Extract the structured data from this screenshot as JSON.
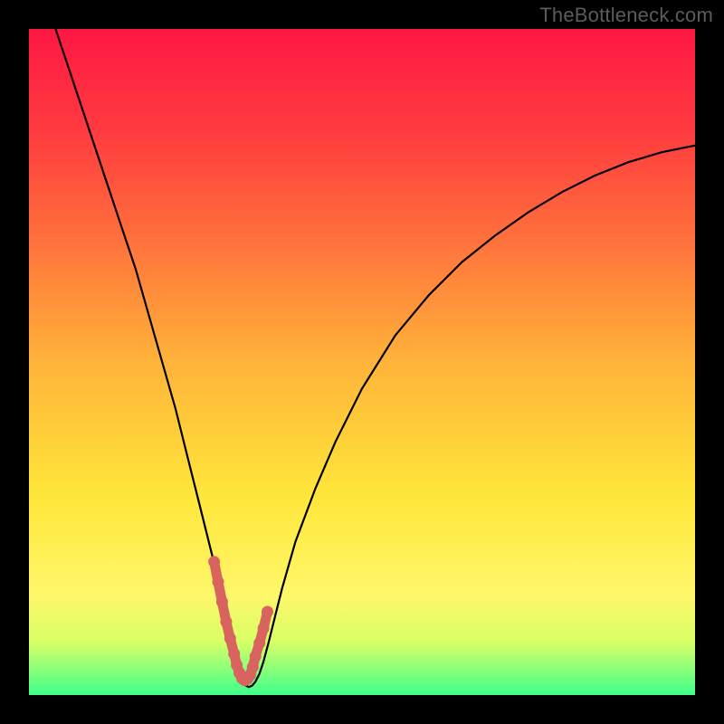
{
  "watermark_text": "TheBottleneck.com",
  "chart_data": {
    "type": "line",
    "title": "",
    "xlabel": "",
    "ylabel": "",
    "xlim": [
      0,
      100
    ],
    "ylim": [
      0,
      100
    ],
    "grid": false,
    "legend": false,
    "background_gradient": {
      "direction": "vertical",
      "stops": [
        {
          "pos": 0.0,
          "color": "#ff1744"
        },
        {
          "pos": 0.15,
          "color": "#ff3a3f"
        },
        {
          "pos": 0.3,
          "color": "#ff6b3c"
        },
        {
          "pos": 0.5,
          "color": "#ffb33a"
        },
        {
          "pos": 0.7,
          "color": "#ffe63a"
        },
        {
          "pos": 0.85,
          "color": "#fff76a"
        },
        {
          "pos": 0.92,
          "color": "#d8ff66"
        },
        {
          "pos": 0.96,
          "color": "#8dff7a"
        },
        {
          "pos": 1.0,
          "color": "#3dff88"
        }
      ]
    },
    "series": [
      {
        "name": "bottleneck-curve",
        "stroke": "#000000",
        "x": [
          4,
          6,
          8,
          10,
          12,
          14,
          16,
          18,
          20,
          22,
          24,
          25,
          26,
          27,
          28,
          29,
          29.8,
          30.5,
          31,
          31.4,
          31.8,
          32.2,
          32.6,
          33,
          33.5,
          34,
          34.6,
          35.2,
          36,
          37,
          38,
          40,
          43,
          46,
          50,
          55,
          60,
          65,
          70,
          75,
          80,
          85,
          90,
          95,
          100
        ],
        "y": [
          100,
          94,
          88,
          82,
          76,
          70,
          64,
          57,
          50,
          43,
          35,
          31,
          27,
          23,
          19,
          15,
          11,
          8,
          5.5,
          3.8,
          2.6,
          1.8,
          1.4,
          1.2,
          1.4,
          2.0,
          3.2,
          5.0,
          8,
          12,
          16,
          23,
          31,
          38,
          46,
          54,
          60,
          65,
          69,
          72.5,
          75.5,
          78,
          80,
          81.5,
          82.5
        ]
      },
      {
        "name": "optimal-range-markers",
        "stroke": "#d9635f",
        "marker": "circle",
        "x": [
          27.8,
          28.4,
          29.0,
          29.6,
          30.2,
          30.8,
          31.2,
          31.6,
          32.0,
          32.4,
          32.8,
          33.2,
          33.6,
          34.0,
          34.6,
          35.2,
          35.8
        ],
        "y": [
          20,
          17,
          14,
          11,
          8.5,
          6.2,
          4.5,
          3.3,
          2.5,
          2.2,
          2.4,
          3.0,
          4.2,
          5.8,
          7.8,
          10,
          12.5
        ]
      }
    ],
    "annotations": []
  }
}
